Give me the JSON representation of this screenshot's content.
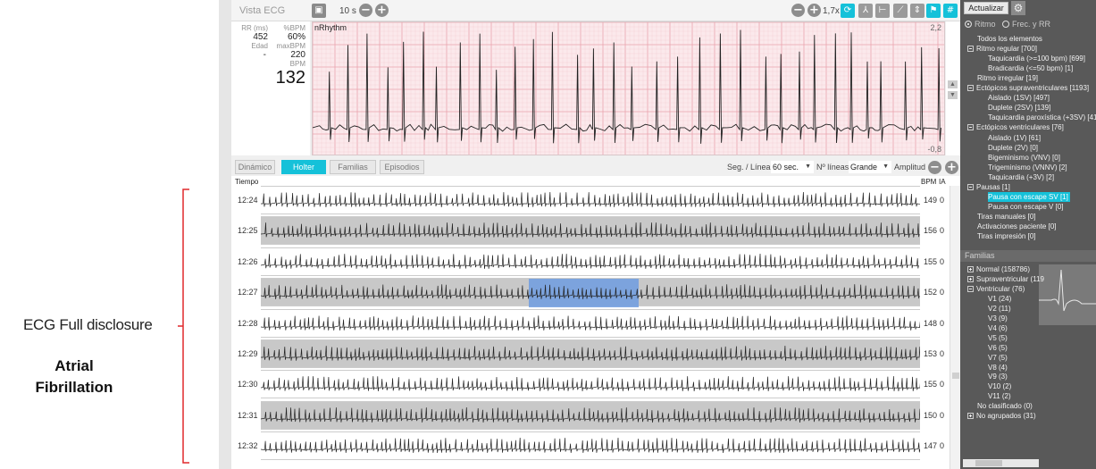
{
  "annotation": {
    "left_label": "ECG Full disclosure",
    "diagnosis": [
      "Atrial",
      "Fibrillation"
    ]
  },
  "toolbar": {
    "title": "Vista ECG",
    "duration": "10 s",
    "zoom": "1,7x"
  },
  "info": {
    "rr_label": "RR (ms)",
    "rr_value": "452",
    "pct_bpm_label": "%BPM",
    "pct_bpm_value": "60%",
    "age_label": "Edad",
    "age_value": "-",
    "max_bpm_label": "maxBPM",
    "max_bpm_value": "220",
    "bpm_label": "BPM",
    "bpm_value": "132"
  },
  "ecg_top": {
    "lead_label": "nRhythm",
    "scale_max": "2,2",
    "scale_min": "-0,8"
  },
  "tabs": [
    "Dinámico",
    "Holter",
    "Familias",
    "Episodios"
  ],
  "active_tab": "Holter",
  "fd_controls": {
    "seg_label": "Seg. / Línea",
    "seg_value": "60 sec.",
    "lines_label": "Nº líneas",
    "lines_value": "Grande",
    "amp_label": "Amplitud"
  },
  "fd_headers": {
    "time": "Tiempo",
    "bpm": "BPM",
    "ia": "IA"
  },
  "fd_rows": [
    {
      "time": "12:24",
      "bpm": "149",
      "ia": "0"
    },
    {
      "time": "12:25",
      "bpm": "156",
      "ia": "0"
    },
    {
      "time": "12:26",
      "bpm": "155",
      "ia": "0"
    },
    {
      "time": "12:27",
      "bpm": "152",
      "ia": "0"
    },
    {
      "time": "12:28",
      "bpm": "148",
      "ia": "0"
    },
    {
      "time": "12:29",
      "bpm": "153",
      "ia": "0"
    },
    {
      "time": "12:30",
      "bpm": "155",
      "ia": "0"
    },
    {
      "time": "12:31",
      "bpm": "150",
      "ia": "0"
    },
    {
      "time": "12:32",
      "bpm": "147",
      "ia": "0"
    }
  ],
  "right_panel": {
    "update_button": "Actualizar",
    "radio_rhythm": "Ritmo",
    "radio_freq": "Frec. y RR",
    "tree": [
      {
        "label": "Todos los elementos",
        "level": 1,
        "exp": ""
      },
      {
        "label": "Ritmo regular [700]",
        "level": 0,
        "exp": "minus"
      },
      {
        "label": "Taquicardia (>=100 bpm) [699]",
        "level": 2,
        "exp": ""
      },
      {
        "label": "Bradicardia (<=50 bpm) [1]",
        "level": 2,
        "exp": ""
      },
      {
        "label": "Ritmo irregular [19]",
        "level": 1,
        "exp": ""
      },
      {
        "label": "Ectópicos supraventriculares [1193]",
        "level": 0,
        "exp": "minus"
      },
      {
        "label": "Aislado (1SV) [497]",
        "level": 2,
        "exp": ""
      },
      {
        "label": "Duplete (2SV) [139]",
        "level": 2,
        "exp": ""
      },
      {
        "label": "Taquicardia paroxística (+3SV) [41]",
        "level": 2,
        "exp": ""
      },
      {
        "label": "Ectópicos ventriculares [76]",
        "level": 0,
        "exp": "minus"
      },
      {
        "label": "Aislado (1V) [61]",
        "level": 2,
        "exp": ""
      },
      {
        "label": "Duplete (2V) [0]",
        "level": 2,
        "exp": ""
      },
      {
        "label": "Bigeminismo (VNV) [0]",
        "level": 2,
        "exp": ""
      },
      {
        "label": "Trigeminismo (VNNV) [2]",
        "level": 2,
        "exp": ""
      },
      {
        "label": "Taquicardia (+3V) [2]",
        "level": 2,
        "exp": ""
      },
      {
        "label": "Pausas [1]",
        "level": 0,
        "exp": "minus"
      },
      {
        "label": "Pausa con escape SV [1]",
        "level": 2,
        "exp": "",
        "selected": true
      },
      {
        "label": "Pausa con escape V [0]",
        "level": 2,
        "exp": ""
      },
      {
        "label": "Tiras manuales [0]",
        "level": 1,
        "exp": ""
      },
      {
        "label": "Activaciones paciente [0]",
        "level": 1,
        "exp": ""
      },
      {
        "label": "Tiras impresión [0]",
        "level": 1,
        "exp": ""
      }
    ],
    "families_title": "Familias",
    "families": [
      {
        "label": "Normal (158786)",
        "level": 0,
        "exp": "plus"
      },
      {
        "label": "Supraventricular (119",
        "level": 0,
        "exp": "plus"
      },
      {
        "label": "Ventricular (76)",
        "level": 0,
        "exp": "minus"
      },
      {
        "label": "V1 (24)",
        "level": 2,
        "exp": ""
      },
      {
        "label": "V2 (11)",
        "level": 2,
        "exp": ""
      },
      {
        "label": "V3 (9)",
        "level": 2,
        "exp": ""
      },
      {
        "label": "V4 (6)",
        "level": 2,
        "exp": ""
      },
      {
        "label": "V5 (5)",
        "level": 2,
        "exp": ""
      },
      {
        "label": "V6 (5)",
        "level": 2,
        "exp": ""
      },
      {
        "label": "V7 (5)",
        "level": 2,
        "exp": ""
      },
      {
        "label": "V8 (4)",
        "level": 2,
        "exp": ""
      },
      {
        "label": "V9 (3)",
        "level": 2,
        "exp": ""
      },
      {
        "label": "V10 (2)",
        "level": 2,
        "exp": ""
      },
      {
        "label": "V11 (2)",
        "level": 2,
        "exp": ""
      },
      {
        "label": "No clasificado (0)",
        "level": 1,
        "exp": ""
      },
      {
        "label": "No agrupados (31)",
        "level": 0,
        "exp": "plus"
      }
    ]
  },
  "colors": {
    "accent": "#15c1d9",
    "ecg_bg": "#fbe9ec",
    "ecg_grid": "#f1b7c0",
    "highlight": "#6f9ce0",
    "bracket": "#e0282c"
  }
}
